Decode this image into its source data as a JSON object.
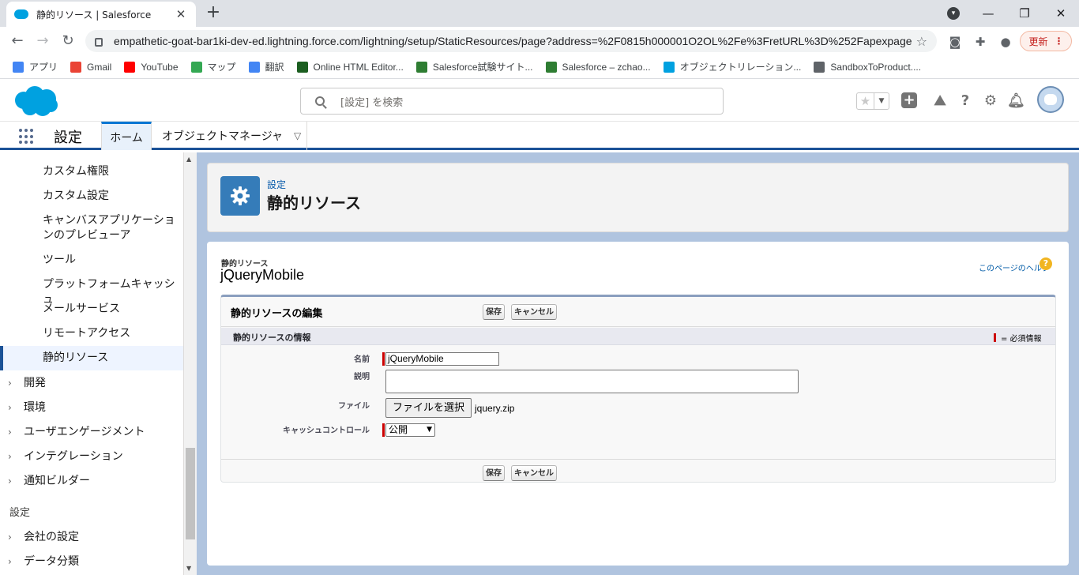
{
  "browser": {
    "tab_title": "静的リソース | Salesforce",
    "url": "empathetic-goat-bar1ki-dev-ed.lightning.force.com/lightning/setup/StaticResources/page?address=%2F0815h000001O2OL%2Fe%3FretURL%3D%252Fapexpage...",
    "update_label": "更新",
    "bookmarks": [
      {
        "label": "アプリ",
        "icon": "apps-grid-icon",
        "color": "#4285f4"
      },
      {
        "label": "Gmail",
        "icon": "gmail-icon",
        "color": "#ea4335"
      },
      {
        "label": "YouTube",
        "icon": "youtube-icon",
        "color": "#ff0000"
      },
      {
        "label": "マップ",
        "icon": "maps-pin-icon",
        "color": "#34a853"
      },
      {
        "label": "翻訳",
        "icon": "translate-icon",
        "color": "#4285f4"
      },
      {
        "label": "Online HTML Editor...",
        "icon": "html-editor-icon",
        "color": "#1b5e20"
      },
      {
        "label": "Salesforce試験サイト...",
        "icon": "salesforce-exam-icon",
        "color": "#2e7d32"
      },
      {
        "label": "Salesforce – zchao...",
        "icon": "salesforce-zchao-icon",
        "color": "#2e7d32"
      },
      {
        "label": "オブジェクトリレーション...",
        "icon": "salesforce-cloud-icon",
        "color": "#00a1e0"
      },
      {
        "label": "SandboxToProduct....",
        "icon": "globe-icon",
        "color": "#5f6368"
      }
    ]
  },
  "header": {
    "search_placeholder": "[設定] を検索",
    "brand_color": "#00a1e0"
  },
  "appnav": {
    "app_name": "設定",
    "tab_home": "ホーム",
    "tab_object_manager": "オブジェクトマネージャ"
  },
  "sidebar": {
    "children": [
      "カスタム権限",
      "カスタム設定",
      "キャンバスアプリケーションのプレビューア",
      "ツール",
      "プラットフォームキャッシュ",
      "メールサービス",
      "リモートアクセス",
      "静的リソース"
    ],
    "active_index": 7,
    "groups": [
      "開発",
      "環境",
      "ユーザエンゲージメント",
      "インテグレーション",
      "通知ビルダー"
    ],
    "section2_title": "設定",
    "section2_groups": [
      "会社の設定",
      "データ分類"
    ]
  },
  "page_header": {
    "small_label": "設定",
    "title": "静的リソース"
  },
  "record": {
    "type_label": "静的リソース",
    "name": "jQueryMobile",
    "help_link": "このページのヘルプ",
    "help_icon": "?"
  },
  "edit_block": {
    "title": "静的リソースの編集",
    "save_label": "保存",
    "cancel_label": "キャンセル",
    "section_title": "静的リソースの情報",
    "required_legend": "= 必須情報",
    "fields": {
      "name_label": "名前",
      "name_value": "jQueryMobile",
      "description_label": "説明",
      "description_value": "",
      "file_label": "ファイル",
      "file_button": "ファイルを選択",
      "file_name": "jquery.zip",
      "cache_label": "キャッシュコントロール",
      "cache_value": "公開"
    }
  }
}
